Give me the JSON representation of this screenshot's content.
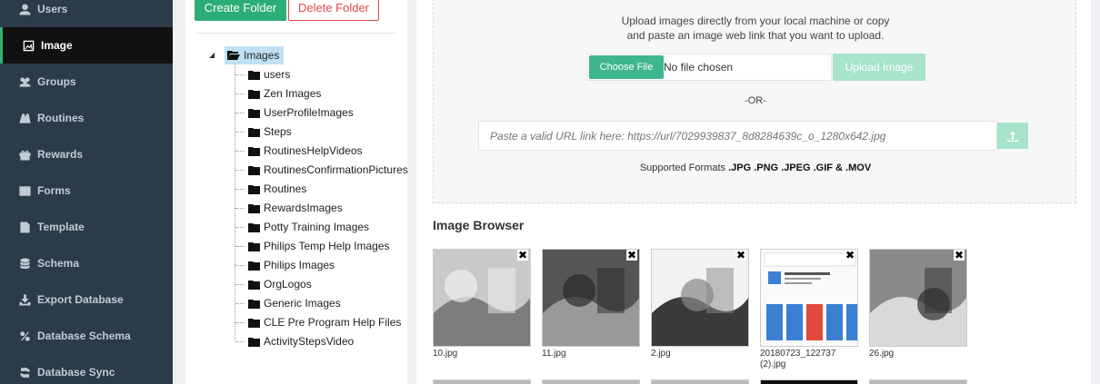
{
  "sidebar": {
    "items": [
      {
        "label": "Users",
        "icon": "user-icon"
      },
      {
        "label": "Image",
        "icon": "image-icon",
        "active": true
      },
      {
        "label": "Groups",
        "icon": "groups-icon"
      },
      {
        "label": "Routines",
        "icon": "routines-icon"
      },
      {
        "label": "Rewards",
        "icon": "gift-icon"
      },
      {
        "label": "Forms",
        "icon": "table-icon"
      },
      {
        "label": "Template",
        "icon": "file-icon"
      },
      {
        "label": "Schema",
        "icon": "database-icon"
      },
      {
        "label": "Export Database",
        "icon": "download-icon"
      },
      {
        "label": "Database Schema",
        "icon": "percent-icon"
      },
      {
        "label": "Database Sync",
        "icon": "sync-icon"
      }
    ]
  },
  "folders": {
    "create_label": "Create Folder",
    "delete_label": "Delete Folder",
    "root": "Images",
    "children": [
      "users",
      "Zen Images",
      "UserProfileImages",
      "Steps",
      "RoutinesHelpVideos",
      "RoutinesConfirmationPictures",
      "Routines",
      "RewardsImages",
      "Potty Training Images",
      "Philips Temp Help Images",
      "Philips Images",
      "OrgLogos",
      "Generic Images",
      "CLE Pre Program Help Files",
      "ActivityStepsVideo"
    ]
  },
  "upload": {
    "description_line1": "Upload images directly from your local machine or copy",
    "description_line2": "and paste an image web link that you want to upload.",
    "choose_label": "Choose File",
    "no_file": "No file chosen",
    "upload_label": "Upload Image",
    "or": "-OR-",
    "url_placeholder": "Paste a valid URL link here: https://url/7029939837_8d8284639c_o_1280x642.jpg",
    "formats_prefix": "Supported Formats",
    "formats": ".JPG .PNG .JPEG .GIF & .MOV"
  },
  "browser": {
    "title": "Image Browser",
    "images": [
      {
        "name": "10.jpg"
      },
      {
        "name": "11.jpg"
      },
      {
        "name": "2.jpg"
      },
      {
        "name": "20180723_122737 (2).jpg"
      },
      {
        "name": "26.jpg"
      }
    ]
  },
  "colors": {
    "sidebar_bg": "#2c3b4a",
    "accent_green": "#2cad77",
    "danger_red": "#e0484c",
    "upload_disabled": "#a8e3cc"
  }
}
